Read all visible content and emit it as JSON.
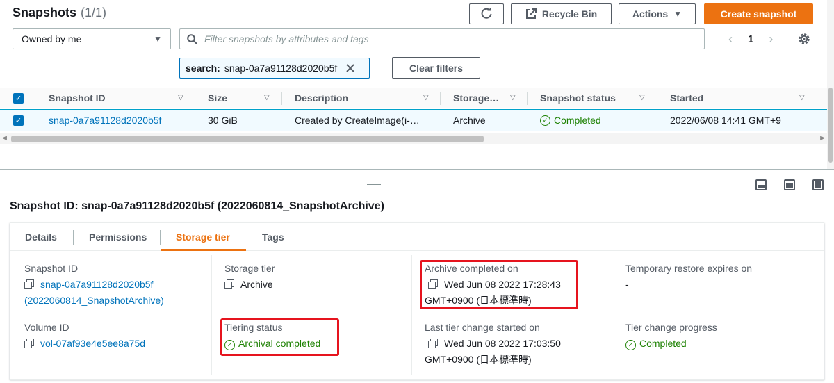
{
  "header": {
    "title": "Snapshots",
    "count": "(1/1)",
    "refresh_label": "",
    "recycle_bin_label": "Recycle Bin",
    "actions_label": "Actions",
    "create_label": "Create snapshot"
  },
  "filters": {
    "owner_select": "Owned by me",
    "search_placeholder": "Filter snapshots by attributes and tags",
    "token_key": "search:",
    "token_value": "snap-0a7a91128d2020b5f",
    "clear_label": "Clear filters"
  },
  "pagination": {
    "page": "1"
  },
  "table": {
    "columns": [
      "Snapshot ID",
      "Size",
      "Description",
      "Storage…",
      "Snapshot status",
      "Started"
    ],
    "row": {
      "id": "snap-0a7a91128d2020b5f",
      "size": "30 GiB",
      "description": "Created by CreateImage(i-…",
      "storage": "Archive",
      "status": "Completed",
      "started": "2022/06/08 14:41 GMT+9"
    }
  },
  "detail": {
    "title": "Snapshot ID: snap-0a7a91128d2020b5f (2022060814_SnapshotArchive)",
    "tabs": [
      "Details",
      "Permissions",
      "Storage tier",
      "Tags"
    ],
    "fields": {
      "snapshot_id_label": "Snapshot ID",
      "snapshot_id_line1": "snap-0a7a91128d2020b5f",
      "snapshot_id_line2": "(2022060814_SnapshotArchive)",
      "storage_tier_label": "Storage tier",
      "storage_tier_value": "Archive",
      "archive_completed_label": "Archive completed on",
      "archive_completed_line1": "Wed Jun 08 2022 17:28:43",
      "archive_completed_line2": "GMT+0900 (日本標準時)",
      "temp_restore_label": "Temporary restore expires on",
      "temp_restore_value": "-",
      "volume_id_label": "Volume ID",
      "volume_id_value": "vol-07af93e4e5ee8a75d",
      "tiering_status_label": "Tiering status",
      "tiering_status_value": "Archival completed",
      "last_tier_change_label": "Last tier change started on",
      "last_tier_change_line1": "Wed Jun 08 2022 17:03:50",
      "last_tier_change_line2": "GMT+0900 (日本標準時)",
      "tier_progress_label": "Tier change progress",
      "tier_progress_value": "Completed"
    }
  },
  "colors": {
    "primary_orange": "#ec7211",
    "link_blue": "#0073bb",
    "success_green": "#1d8102",
    "highlight_red": "#e6141e"
  },
  "icons": [
    "refresh-icon",
    "external-link-icon",
    "caret-down-icon",
    "search-icon",
    "close-icon",
    "chevron-left-icon",
    "chevron-right-icon",
    "gear-icon",
    "checkbox-checked-icon",
    "sort-icon",
    "check-circle-icon",
    "copy-icon",
    "drag-handle-icon",
    "layout-bottom-icon",
    "layout-split-icon",
    "layout-full-icon"
  ]
}
